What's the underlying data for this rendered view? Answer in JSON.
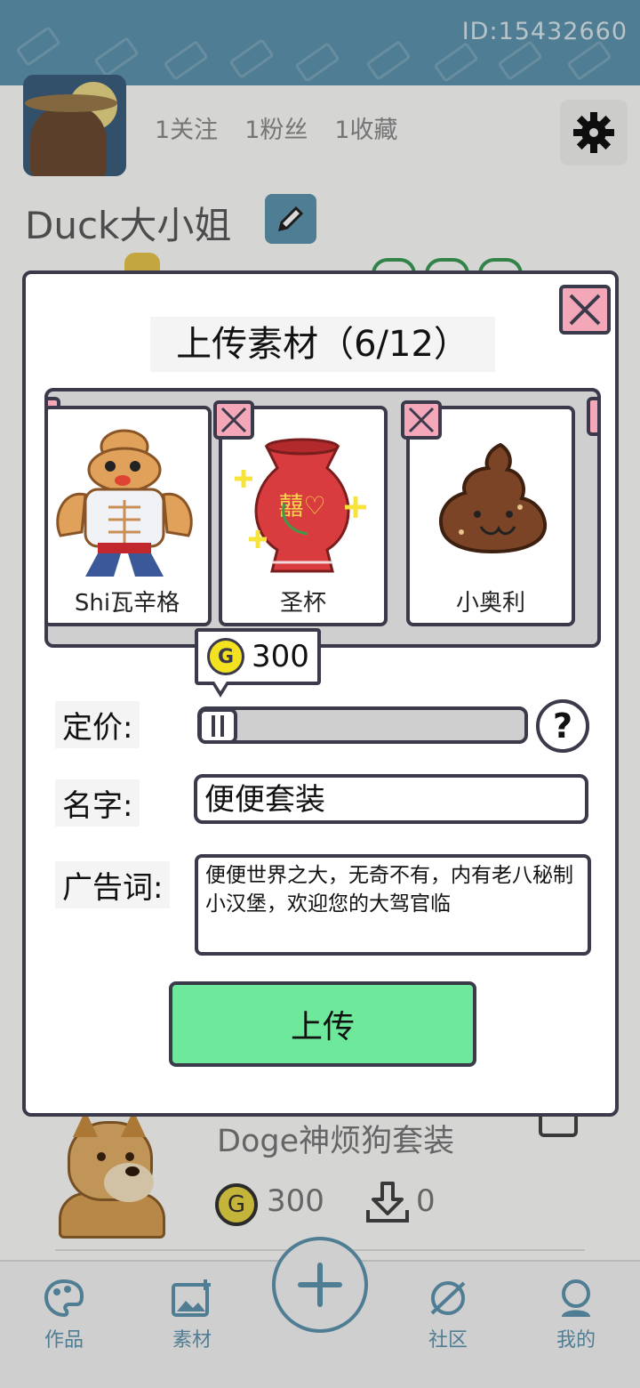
{
  "header": {
    "user_id": "ID:15432660"
  },
  "profile": {
    "stats": [
      "1关注",
      "1粉丝",
      "1收藏"
    ],
    "username": "Duck大小姐"
  },
  "card": {
    "title": "Doge神烦狗套装",
    "price": "300",
    "downloads": "0"
  },
  "bottom_nav": {
    "items": [
      {
        "label": "作品",
        "icon": "palette-icon"
      },
      {
        "label": "素材",
        "icon": "image-plus-icon"
      },
      {
        "label": "社区",
        "icon": "planet-icon"
      },
      {
        "label": "我的",
        "icon": "user-icon"
      }
    ],
    "fab_icon": "plus-icon"
  },
  "modal": {
    "title": "上传素材（6/12）",
    "materials": [
      {
        "name": "Shi瓦辛格",
        "icon": "muscle-poop-icon"
      },
      {
        "name": "圣杯",
        "icon": "red-vase-icon"
      },
      {
        "name": "小奥利",
        "icon": "poop-icon"
      }
    ],
    "price_label": "定价:",
    "price_value": "300",
    "name_label": "名字:",
    "name_value": "便便套装",
    "ad_label": "广告词:",
    "ad_value": "便便世界之大，无奇不有，内有老八秘制小汉堡，欢迎您的大驾官临",
    "upload_button": "上传",
    "help_glyph": "?",
    "coin_glyph": "G"
  },
  "colors": {
    "accent": "#5d93ad",
    "pink": "#f3a7b9",
    "green": "#6ee89a",
    "coin": "#f2e21f"
  }
}
